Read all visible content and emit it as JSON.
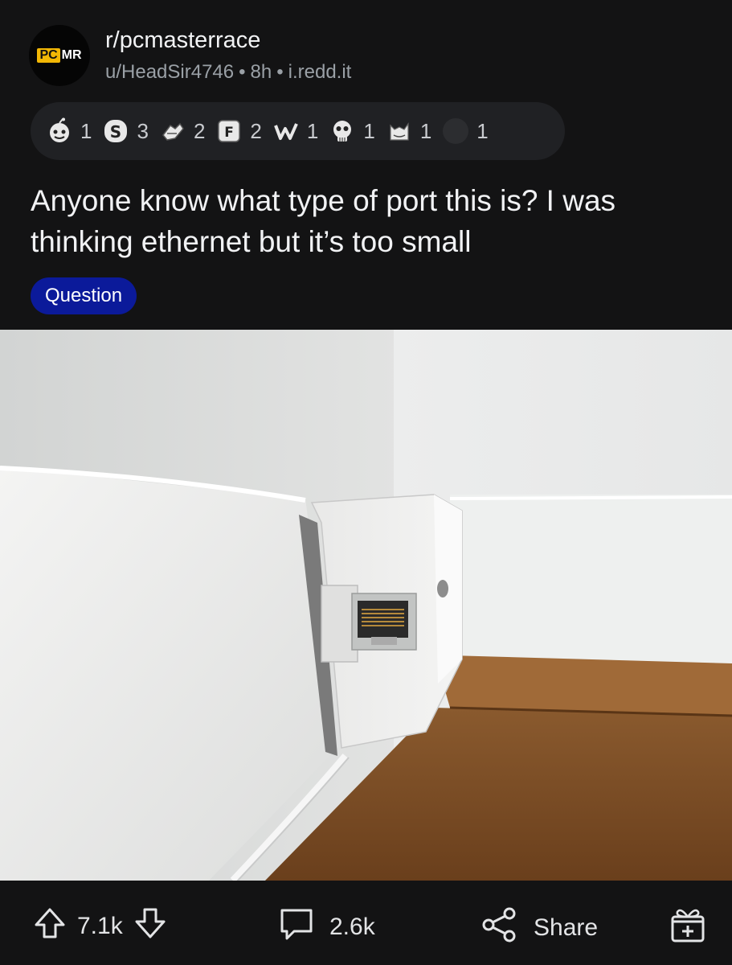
{
  "post": {
    "subreddit": "r/pcmasterrace",
    "avatar_logo": {
      "pc": "PC",
      "mr": "MR"
    },
    "author": "u/HeadSir4746",
    "age": "8h",
    "domain": "i.redd.it",
    "title": "Anyone know what type of port this is? I was thinking ethernet but it’s too small",
    "flair": "Question",
    "flair_color": "#0b1a9a"
  },
  "awards": [
    {
      "icon": "snoo-face-award-icon",
      "count": "1"
    },
    {
      "icon": "silver-coin-award-icon",
      "count": "3"
    },
    {
      "icon": "helpful-hands-award-icon",
      "count": "2"
    },
    {
      "icon": "f-key-award-icon",
      "count": "2"
    },
    {
      "icon": "wholesome-award-icon",
      "count": "1"
    },
    {
      "icon": "laughing-skull-award-icon",
      "count": "1"
    },
    {
      "icon": "cat-award-icon",
      "count": "1"
    },
    {
      "icon": "dark-circle-award-icon",
      "count": "1"
    }
  ],
  "image": {
    "description_icon": "photo-of-wall-port"
  },
  "actions": {
    "upvotes": "7.1k",
    "comments": "2.6k",
    "share": "Share"
  },
  "colors": {
    "background": "#131314",
    "accent_gold": "#f2b705"
  }
}
